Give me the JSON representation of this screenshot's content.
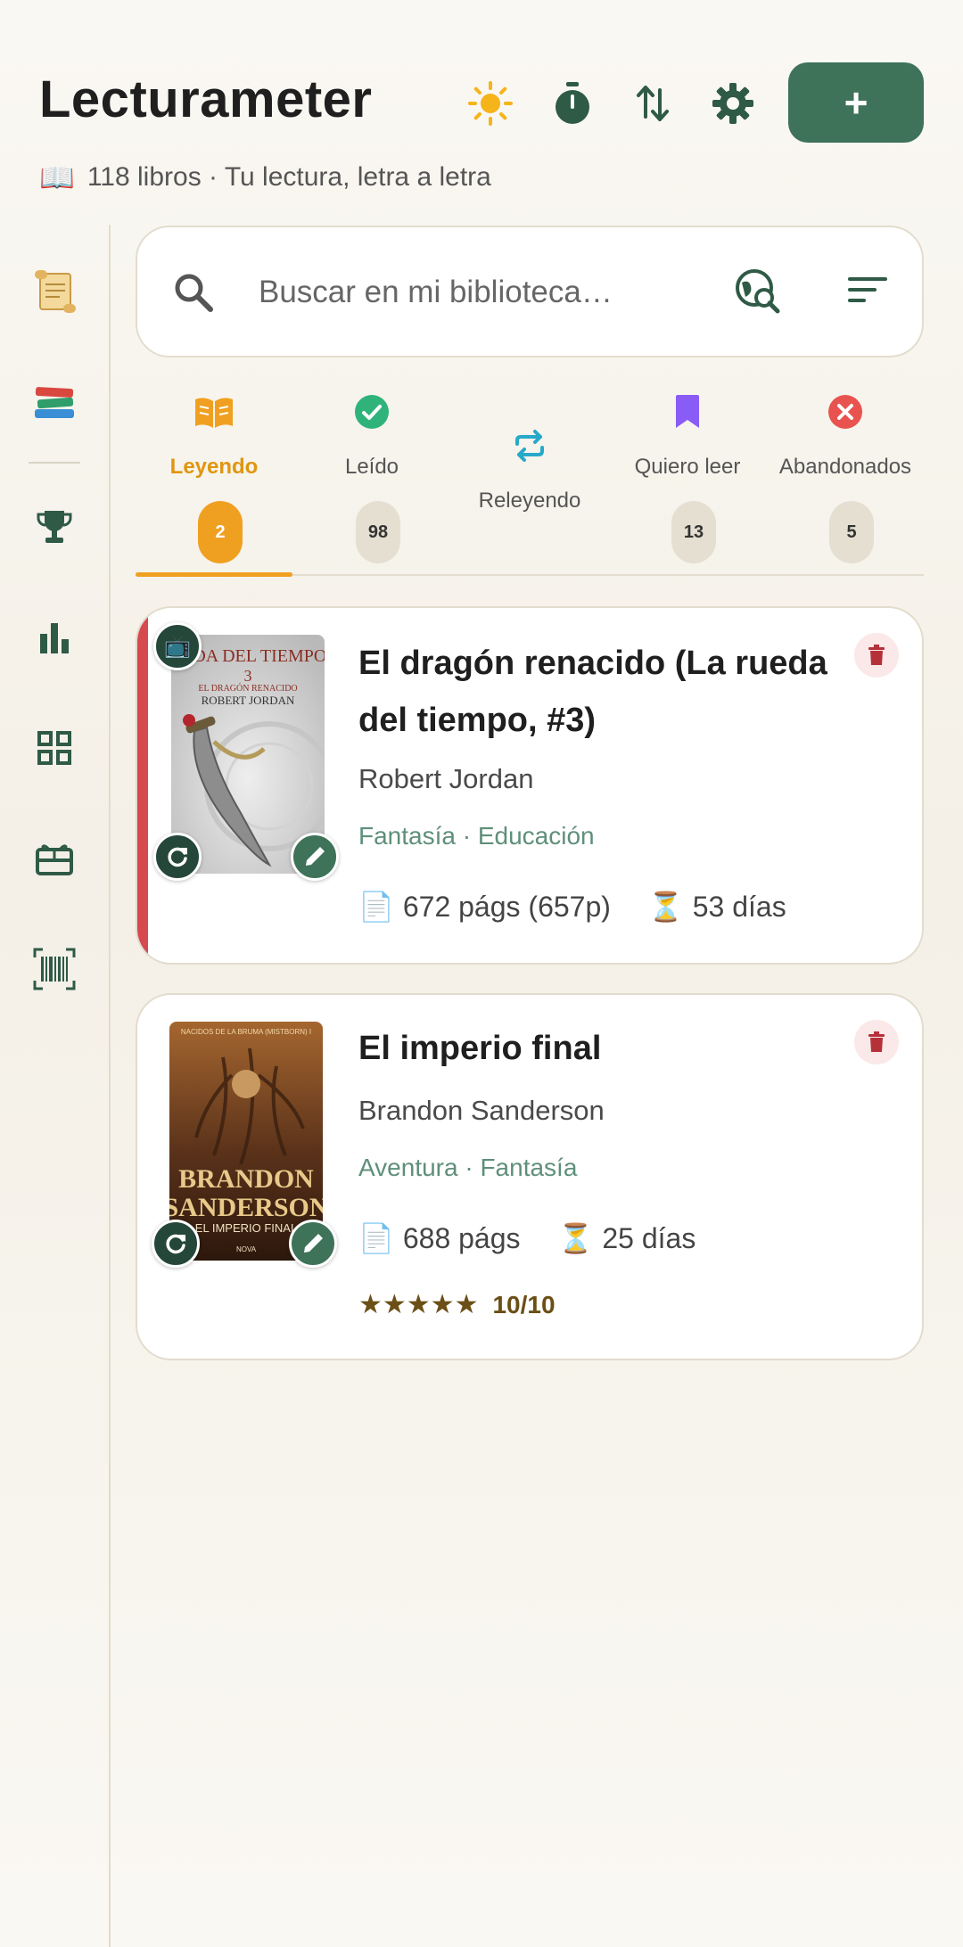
{
  "header": {
    "title": "Lecturameter",
    "subtitle_icon": "📖",
    "subtitle": "118 libros · Tu lectura, letra a letra",
    "add_label": "+"
  },
  "search": {
    "placeholder": "Buscar en mi biblioteca…"
  },
  "tabs": [
    {
      "label": "Leyendo",
      "count": "2",
      "icon": "open-book-icon",
      "color": "#f0a020"
    },
    {
      "label": "Leído",
      "count": "98",
      "icon": "check-circle-icon",
      "color": "#2fb37a"
    },
    {
      "label": "Releyendo",
      "icon": "repeat-icon",
      "color": "#27a9c9"
    },
    {
      "label": "Quiero leer",
      "count": "13",
      "icon": "bookmark-icon",
      "color": "#8a5cf6"
    },
    {
      "label": "Abandonados",
      "count": "5",
      "icon": "x-circle-icon",
      "color": "#e8534f"
    }
  ],
  "books": [
    {
      "title": "El dragón renacido (La rueda del tiempo, #3)",
      "author": "Robert Jordan",
      "genres": "Fantasía · Educación",
      "pages_icon": "📄",
      "pages": "672 págs (657p)",
      "days_icon": "⏳",
      "days": "53 días",
      "cover_title": "UEDA DEL TIEMPO",
      "cover_number": "3",
      "cover_subtitle": "EL DRAGÓN RENACIDO",
      "cover_author": "ROBERT JORDAN",
      "format_icon": "📺"
    },
    {
      "title": "El imperio final",
      "author": "Brandon Sanderson",
      "genres": "Aventura · Fantasía",
      "pages_icon": "📄",
      "pages": "688 págs",
      "days_icon": "⏳",
      "days": "25 días",
      "stars": "★★★★★",
      "rating": "10/10",
      "cover_series": "NACIDOS DE LA BRUMA (MISTBORN) I",
      "cover_author_1": "BRANDON",
      "cover_author_2": "SANDERSON",
      "cover_title": "EL IMPERIO FINAL",
      "cover_publisher": "NOVA"
    }
  ],
  "colors": {
    "primary": "#3e7259",
    "accent": "#f0a020",
    "reading_marker": "#d5494f"
  }
}
